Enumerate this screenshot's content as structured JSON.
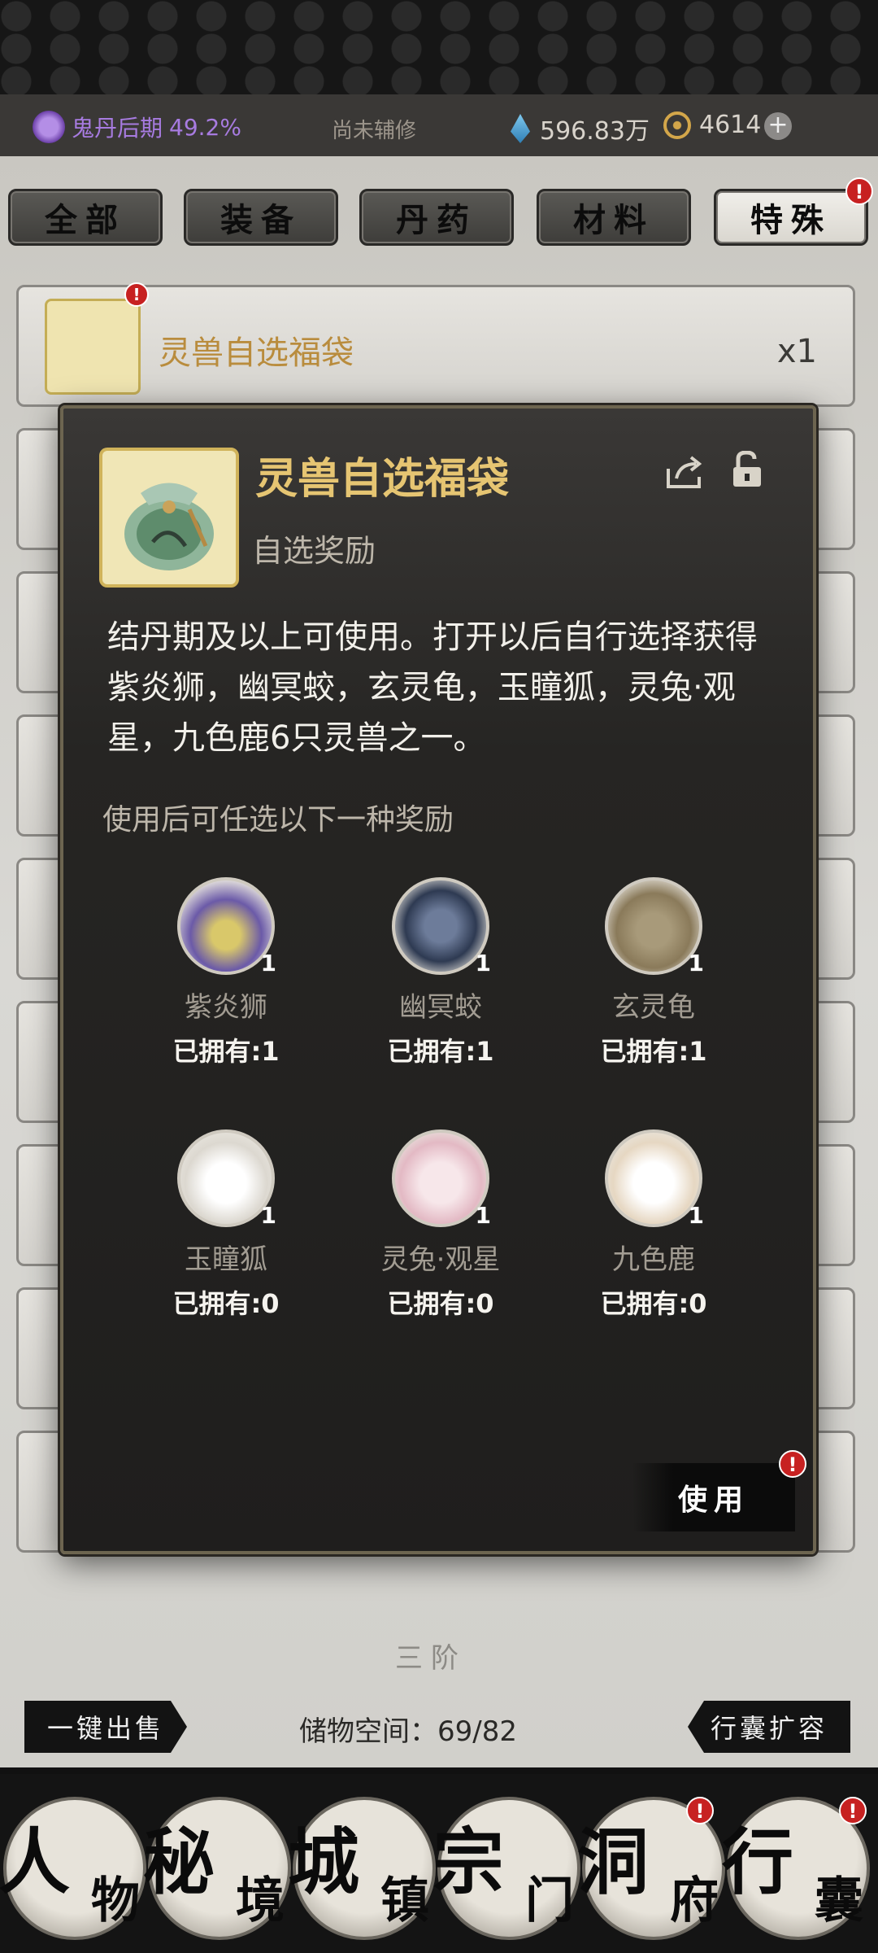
{
  "status": {
    "realm_name": "鬼丹后期",
    "realm_pct": "49.2%",
    "cultivate": "尚未辅修",
    "spirit_stones": "596.83万",
    "coins": "4614",
    "plus": "+"
  },
  "tabs": [
    {
      "label": "全部"
    },
    {
      "label": "装备"
    },
    {
      "label": "丹药"
    },
    {
      "label": "材料"
    },
    {
      "label": "特殊"
    }
  ],
  "badges": {
    "mark": "!"
  },
  "inventory": {
    "first_item": {
      "name": "灵兽自选福袋",
      "qty": "x1"
    }
  },
  "modal": {
    "title": "灵兽自选福袋",
    "subtitle": "自选奖励",
    "description": "结丹期及以上可使用。打开以后自行选择获得紫炎狮，幽冥蛟，玄灵龟，玉瞳狐，灵兔·观星，九色鹿6只灵兽之一。",
    "hint": "使用后可任选以下一种奖励",
    "pets": [
      {
        "name": "紫炎狮",
        "count": "1",
        "owned": "已拥有:1",
        "color": "#6b5aa8"
      },
      {
        "name": "幽冥蛟",
        "count": "1",
        "owned": "已拥有:1",
        "color": "#2e3a52"
      },
      {
        "name": "玄灵龟",
        "count": "1",
        "owned": "已拥有:1",
        "color": "#8a7a5a"
      },
      {
        "name": "玉瞳狐",
        "count": "1",
        "owned": "已拥有:0",
        "color": "#dcd8d0"
      },
      {
        "name": "灵兔·观星",
        "count": "1",
        "owned": "已拥有:0",
        "color": "#e3b9c4"
      },
      {
        "name": "九色鹿",
        "count": "1",
        "owned": "已拥有:0",
        "color": "#e6d7c2"
      }
    ],
    "use_label": "使用"
  },
  "footer": {
    "sell_all": "一键出售",
    "storage": "储物空间：69/82",
    "expand": "行囊扩容",
    "tier": "三阶"
  },
  "nav": [
    {
      "big": "人",
      "small": "物"
    },
    {
      "big": "秘",
      "small": "境"
    },
    {
      "big": "城",
      "small": "镇"
    },
    {
      "big": "宗",
      "small": "门"
    },
    {
      "big": "洞",
      "small": "府"
    },
    {
      "big": "行",
      "small": "囊"
    }
  ]
}
